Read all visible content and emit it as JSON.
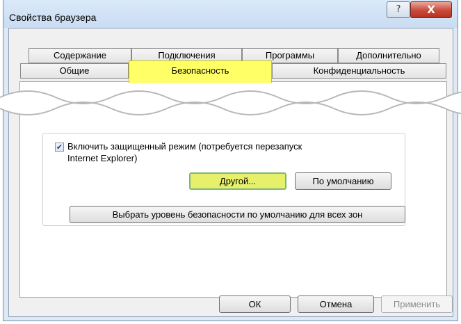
{
  "window": {
    "title": "Свойства браузера",
    "help_icon": "?",
    "close_icon": "X"
  },
  "tabs": {
    "row1": [
      "Содержание",
      "Подключения",
      "Программы",
      "Дополнительно"
    ],
    "row2": [
      "Общие",
      "Безопасность",
      "Конфиденциальность"
    ],
    "active": "Безопасность"
  },
  "protected_mode": {
    "checked": true,
    "check_glyph": "✔",
    "label_line1": "Включить защищенный режим (потребуется перезапуск",
    "label_line2": "Internet Explorer)"
  },
  "zone_buttons": {
    "custom": "Другой...",
    "default": "По умолчанию"
  },
  "reset_all_button": "Выбрать уровень безопасности по умолчанию для всех зон",
  "dialog_buttons": {
    "ok": "ОК",
    "cancel": "Отмена",
    "apply": "Применить"
  },
  "colors": {
    "highlight": "#ffff66",
    "button_highlight": "#e7f06b"
  }
}
